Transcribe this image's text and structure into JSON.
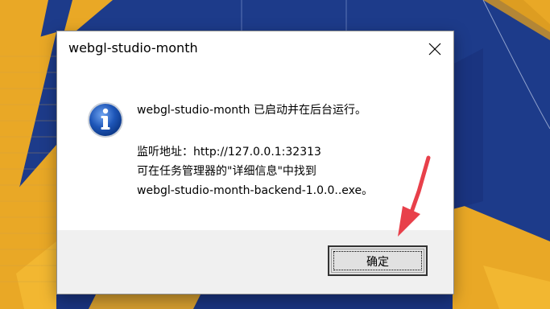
{
  "dialog": {
    "title": "webgl-studio-month",
    "close_icon": "close-icon",
    "icon": "info-icon",
    "message_line1": "webgl-studio-month 已启动并在后台运行。",
    "message_line2": "监听地址：http://127.0.0.1:32313",
    "message_line3": "可在任务管理器的\"详细信息\"中找到",
    "message_line4": "webgl-studio-month-backend-1.0.0..exe。",
    "ok_label": "确定"
  },
  "colors": {
    "background": "#1d3b8a",
    "background_accent": "#e9a826",
    "dialog_footer": "#f0f0f0",
    "annotation_arrow": "#e8404a",
    "info_icon": "#1e56b8"
  }
}
